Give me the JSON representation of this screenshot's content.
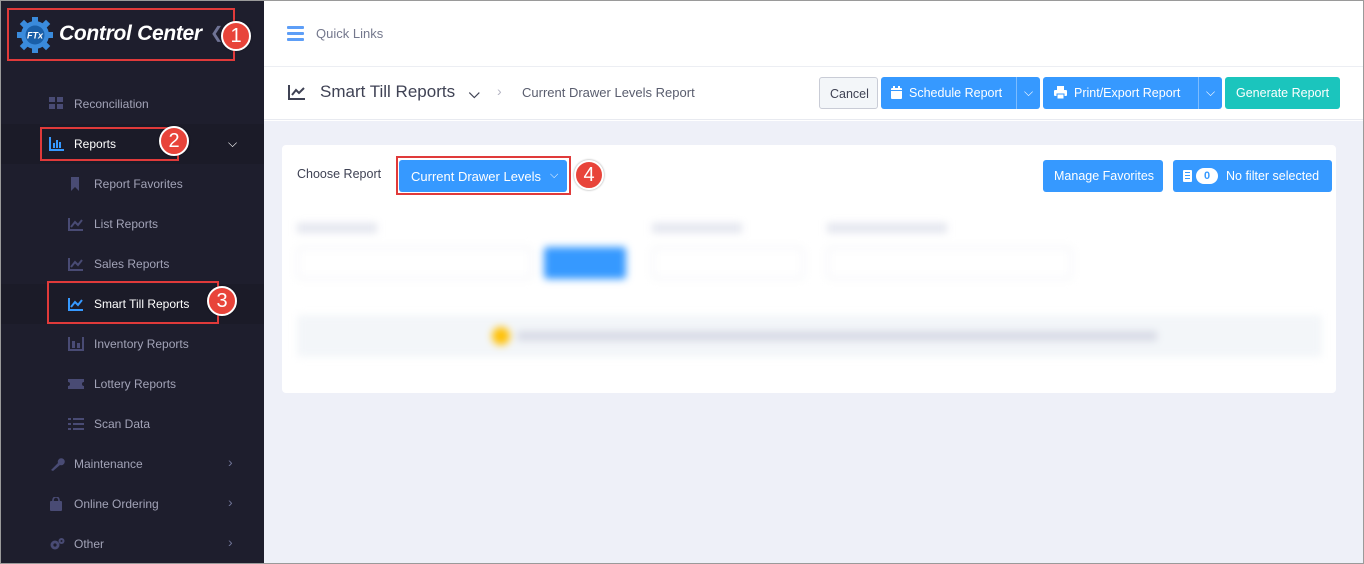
{
  "app": {
    "logo_badge": "FTx",
    "logo_text": "Control Center",
    "collapse_icon": "chevron-left-icon"
  },
  "sidebar": {
    "items": [
      {
        "label": "Reconciliation",
        "icon": "grid-icon"
      },
      {
        "label": "Reports",
        "icon": "bar-chart-icon",
        "expanded": true
      },
      {
        "label": "Report Favorites",
        "icon": "bookmark-icon"
      },
      {
        "label": "List Reports",
        "icon": "line-chart-icon"
      },
      {
        "label": "Sales Reports",
        "icon": "line-chart-icon"
      },
      {
        "label": "Smart Till Reports",
        "icon": "line-chart-icon",
        "active": true
      },
      {
        "label": "Inventory Reports",
        "icon": "inventory-icon"
      },
      {
        "label": "Lottery Reports",
        "icon": "ticket-icon"
      },
      {
        "label": "Scan Data",
        "icon": "list-icon"
      },
      {
        "label": "Maintenance",
        "icon": "wrench-icon"
      },
      {
        "label": "Online Ordering",
        "icon": "bag-icon"
      },
      {
        "label": "Other",
        "icon": "gears-icon"
      }
    ]
  },
  "topbar": {
    "quick_links_label": "Quick Links"
  },
  "subheader": {
    "title": "Smart Till Reports",
    "breadcrumb": "Current Drawer Levels Report",
    "cancel_label": "Cancel",
    "schedule_label": "Schedule Report",
    "print_label": "Print/Export Report",
    "generate_label": "Generate Report"
  },
  "report_card": {
    "choose_label": "Choose Report",
    "selected_report": "Current Drawer Levels",
    "manage_favorites_label": "Manage Favorites",
    "filter_count": "0",
    "filter_label": "No filter selected"
  },
  "annotations": [
    "1",
    "2",
    "3",
    "4"
  ],
  "colors": {
    "sidebar_bg": "#1e1e2d",
    "primary": "#3699ff",
    "success": "#1bc5bd",
    "annotation_red": "#e03a3a"
  }
}
